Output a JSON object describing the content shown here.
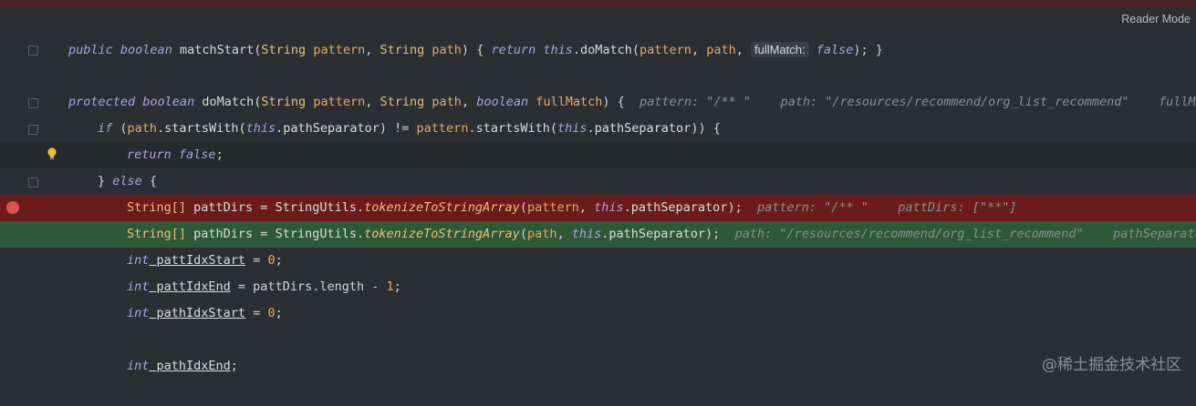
{
  "toolbar": {
    "reader_mode": "Reader Mode"
  },
  "icons": {
    "fold": "fold-icon",
    "bulb": "lightbulb-icon",
    "breakpoint": "breakpoint-icon"
  },
  "colors": {
    "breakpoint_line": "#6c1b1b",
    "execution_line": "#2f5838",
    "current_line": "#252a2d",
    "background": "#2b2f34"
  },
  "lines": {
    "l1": {
      "kw1": "public",
      "kw2": "boolean",
      "name": "matchStart",
      "p1": "(",
      "t1": "String",
      "a1": "pattern",
      "c1": ", ",
      "t2": "String",
      "a2": "path",
      "c2": ") { ",
      "kw3": "return",
      "dot1": " ",
      "thisv": "this",
      "m": ".doMatch(",
      "v1": "pattern",
      "c3": ", ",
      "v2": "path",
      "c4": ", ",
      "inlay": "fullMatch:",
      "kw4": "false",
      "end": "); }"
    },
    "l2": {
      "kw1": "protected",
      "kw2": "boolean",
      "name": "doMatch",
      "p1": "(",
      "t1": "String",
      "a1": "pattern",
      "c1": ", ",
      "t2": "String",
      "a2": "path",
      "c2": ", ",
      "kw3": "boolean",
      "a3": "fullMatch",
      "end": ") {",
      "h1k": "pattern: ",
      "h1v": "\"/** \"",
      "h2k": "path: ",
      "h2v": "\"/resources/recommend/org_list_recommend\"",
      "h3k": "fullMatc"
    },
    "l3": {
      "kw": "if",
      "a": " (",
      "v1": "path",
      "m1": ".startsWith(",
      "t1": "this",
      "f1": ".pathSeparator",
      "ne": ") != ",
      "v2": "pattern",
      "m2": ".startsWith(",
      "t2": "this",
      "f2": ".pathSeparator",
      "end": ")) {"
    },
    "l4": {
      "kw1": "return",
      "kw2": "false",
      "end": ";"
    },
    "l5": {
      "b": "} ",
      "kw": "else",
      "end": " {"
    },
    "l6": {
      "type": "String[]",
      "var": " pattDirs = ",
      "cls": "StringUtils",
      "dot": ".",
      "fn": "tokenizeToStringArray",
      "p": "(",
      "v1": "pattern",
      "c": ", ",
      "thisv": "this",
      "f": ".pathSeparator",
      "end": ");",
      "h1k": "pattern: ",
      "h1v": "\"/** \"",
      "h2k": "pattDirs: ",
      "h2v": "[\"**\"]"
    },
    "l7": {
      "type": "String[]",
      "var": " pathDirs = ",
      "cls": "StringUtils",
      "dot": ".",
      "fn": "tokenizeToStringArray",
      "p": "(",
      "v1": "path",
      "c": ", ",
      "thisv": "this",
      "f": ".pathSeparator",
      "end": ");",
      "h1k": "path: ",
      "h1v": "\"/resources/recommend/org_list_recommend\"",
      "h2k": "pathSeparator"
    },
    "l8": {
      "kw": "int",
      "var": " pattIdxStart",
      "op": " = ",
      "num": "0",
      "end": ";"
    },
    "l9": {
      "kw": "int",
      "var": " pattIdxEnd",
      "op": " = pattDirs.length - ",
      "num": "1",
      "end": ";"
    },
    "l10": {
      "kw": "int",
      "var": " pathIdxStart",
      "op": " = ",
      "num": "0",
      "end": ";"
    },
    "l12": {
      "kw": "int",
      "var": " pathIdxEnd",
      "end": ";"
    }
  },
  "watermark": "@稀土掘金技术社区"
}
